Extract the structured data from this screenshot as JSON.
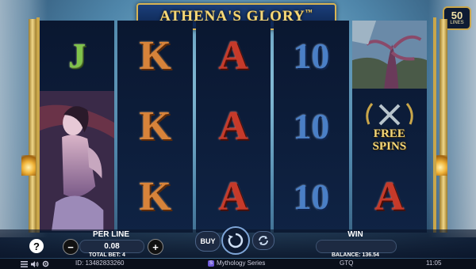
{
  "game": {
    "title": "ATHENA'S GLORY",
    "trademark": "™",
    "lines_count": "50",
    "lines_label": "LINES"
  },
  "reels": [
    {
      "symbols": [
        "J",
        "character-art",
        "character-art"
      ]
    },
    {
      "symbols": [
        "K",
        "K",
        "K"
      ]
    },
    {
      "symbols": [
        "A",
        "A",
        "A"
      ]
    },
    {
      "symbols": [
        "10",
        "10",
        "10"
      ]
    },
    {
      "symbols": [
        "landscape-art",
        "FREE SPINS",
        "A"
      ]
    }
  ],
  "free_spins_text": {
    "line1": "FREE",
    "line2": "SPINS"
  },
  "controls": {
    "help_label": "?",
    "per_line_label": "PER LINE",
    "per_line_value": "0.08",
    "minus_label": "−",
    "plus_label": "+",
    "buy_label": "BUY",
    "win_label": "WIN",
    "total_bet_text": "TOTAL BET: 4",
    "balance_text": "BALANCE: 136.54"
  },
  "statusbar": {
    "id_text": "ID: 13482833260",
    "series_text": "Mythology Series",
    "series_icon": "S",
    "currency": "GTQ",
    "time": "11:05"
  },
  "colors": {
    "gold": "#c9a64a",
    "reel_bg": "#0a1730",
    "symbol_J": "#7fc44a",
    "symbol_K": "#d7833a",
    "symbol_A": "#c63a2a",
    "symbol_10": "#4a7fc6"
  }
}
